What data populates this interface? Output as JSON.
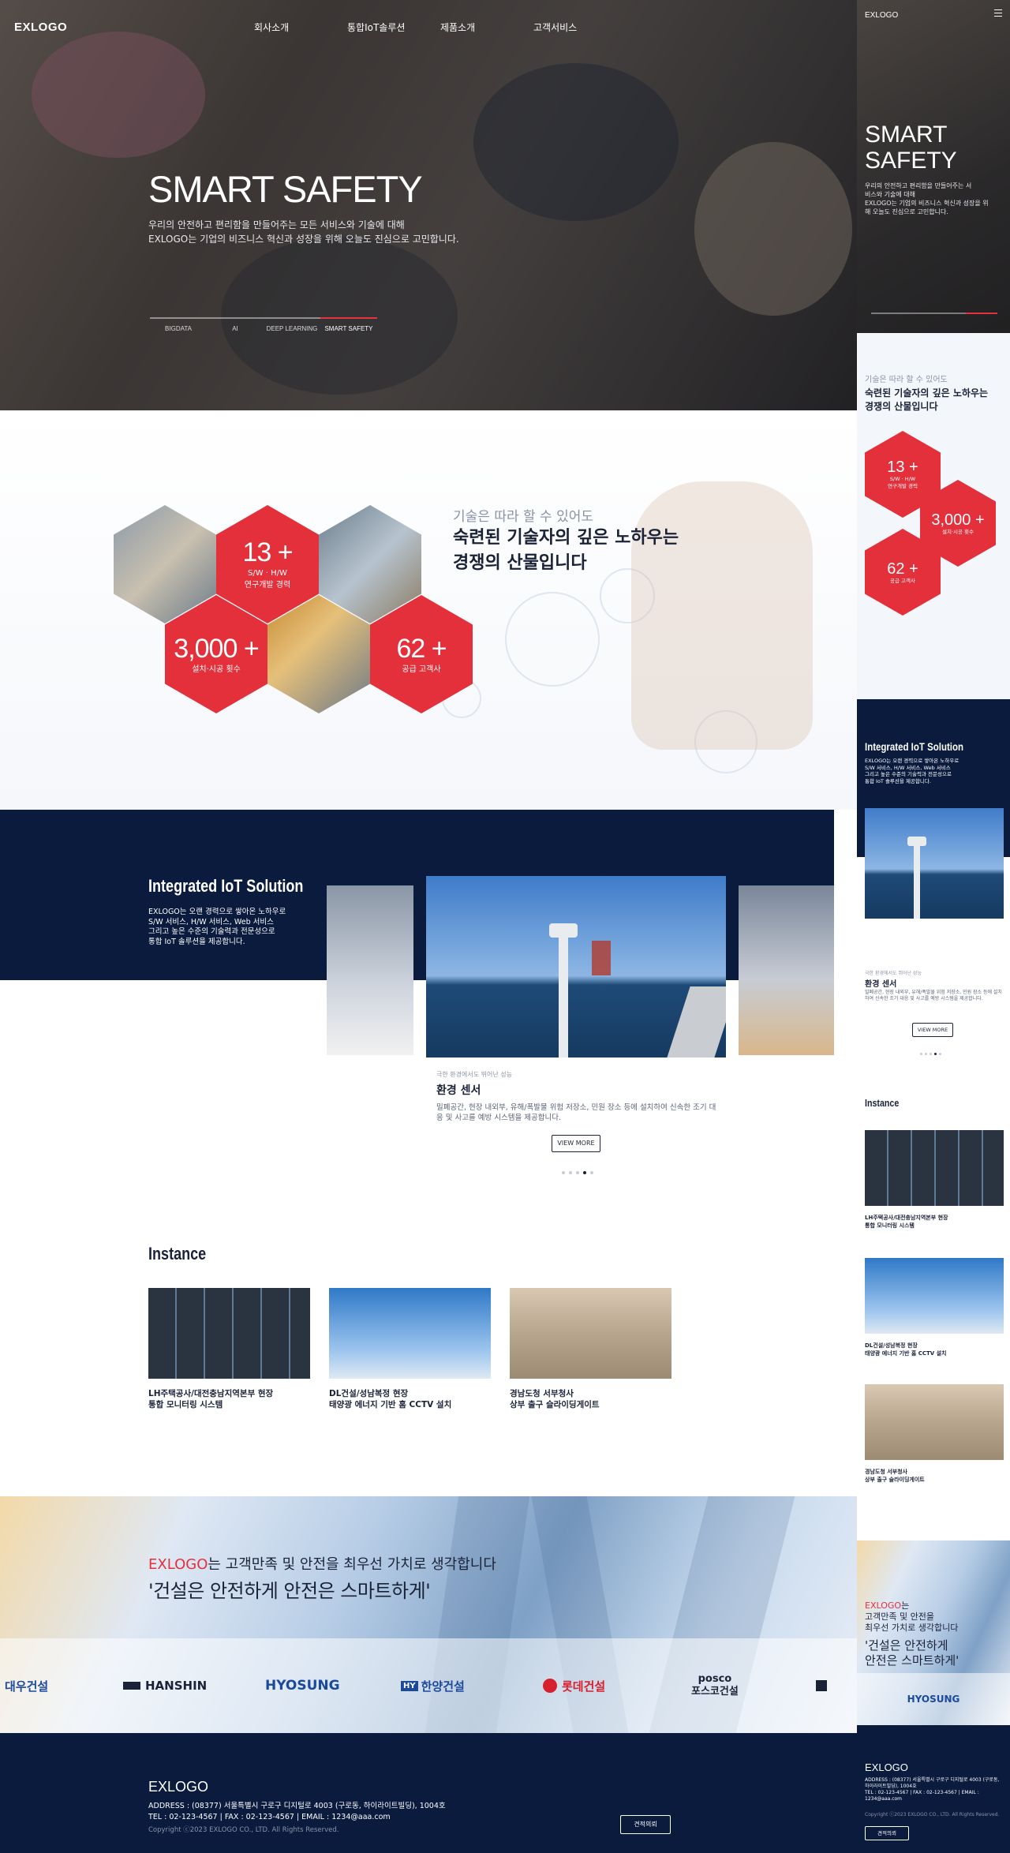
{
  "brand": {
    "logo": "EXLOGO",
    "accent": "#e4303b",
    "navy": "#0b1b3e"
  },
  "nav": {
    "items": [
      "회사소개",
      "통합IoT솔루션",
      "제품소개",
      "고객서비스"
    ]
  },
  "hero": {
    "title": "SMART SAFETY",
    "desc_1": "우리의 안전하고 편리함을 만들어주는 모든 서비스와 기술에 대해",
    "desc_2": "EXLOGO는 기업의 비즈니스 혁신과 성장을 위해 오늘도 진심으로 고민합니다.",
    "tabs": [
      "BIGDATA",
      "AI",
      "DEEP LEARNING",
      "SMART SAFETY"
    ],
    "active_tab": "SMART SAFETY"
  },
  "tech": {
    "subtitle": "기술은 따라 할 수 있어도",
    "headline_1": "숙련된 기술자의 깊은 노하우는",
    "headline_2": "경쟁의 산물입니다",
    "stats": [
      {
        "num": "13 +",
        "label_1": "S/W · H/W",
        "label_2": "연구개발 경력"
      },
      {
        "num": "3,000 +",
        "label_1": "설치·시공 횟수",
        "label_2": ""
      },
      {
        "num": "62 +",
        "label_1": "공급 고객사",
        "label_2": ""
      }
    ]
  },
  "iot": {
    "title": "Integrated IoT Solution",
    "desc_1": "EXLOGO는 오랜 경력으로 쌓아온 노하우로",
    "desc_2": "S/W 서비스, H/W 서비스, Web 서비스",
    "desc_3": "그리고 높은 수준의 기술력과 전문성으로",
    "desc_4": "통합 IoT 솔루션을 제공합니다.",
    "slide_small": "극한 환경에서도 뛰어난 성능",
    "slide_title": "환경 센서",
    "slide_desc": "밀폐공간, 현장 내외부, 유해/폭발물 위험 저장소, 민원 장소 등에 설치하여 신속한 조기 대응 및 사고를 예방 시스템을 제공합니다.",
    "view_more": "VIEW MORE"
  },
  "instance": {
    "title": "Instance",
    "cards": [
      {
        "line_1": "LH주택공사/대전충남지역본부 현장",
        "line_2": "통합 모니터링 시스템"
      },
      {
        "line_1": "DL건설/성남복정 현장",
        "line_2": "태양광 에너지 기반 홈 CCTV 설치"
      },
      {
        "line_1": "경남도청 서부청사",
        "line_2": "상부 출구 슬라이딩게이트"
      }
    ]
  },
  "slogan": {
    "brand": "EXLOGO",
    "line_1_rest": "는 고객만족 및 안전을 최우선 가치로 생각합니다",
    "line_2": "'건설은 안전하게 안전은 스마트하게'",
    "m_line_1a": "는",
    "m_line_1b": "고객만족 및 안전을",
    "m_line_1c": "최우선 가치로 생각합니다",
    "m_line_2a": "'건설은 안전하게",
    "m_line_2b": "안전은 스마트하게'",
    "partners": [
      "대우건설",
      "HANSHIN",
      "HYOSUNG",
      "한양건설",
      "롯데건설",
      "posco",
      "포스코건설"
    ]
  },
  "footer": {
    "logo": "EXLOGO",
    "address": "ADDRESS : (08377) 서울특별시 구로구 디지털로 4003 (구로동, 하이라이트빌딩), 1004호",
    "contact": "TEL : 02-123-4567 | FAX : 02-123-4567 | EMAIL : 1234@aaa.com",
    "copyright": "Copyright ⓒ2023 EXLOGO CO., LTD. All Rights Reserved.",
    "m_address_1": "ADDRESS : (08377) 서울특별시 구로구 디지털로 4003 (구로동,",
    "m_address_2": "하이라이트빌딩), 1004호",
    "m_contact_1": "TEL : 02-123-4567 | FAX : 02-123-4567 | EMAIL :",
    "m_contact_2": "1234@aaa.com",
    "button": "견적의뢰"
  },
  "mobile": {
    "hero_title_1": "SMART",
    "hero_title_2": "SAFETY",
    "hero_desc_1": "우리의 안전하고 편리함을 만들어주는 서",
    "hero_desc_2": "비스와 기술에 대해",
    "hero_desc_3": "EXLOGO는 기업의 비즈니스 혁신과 성장을 위",
    "hero_desc_4": "해 오늘도 진심으로 고민합니다.",
    "tech_head_1": "숙련된 기술자의 깊은 노하우는",
    "tech_head_2": "경쟁의 산물입니다",
    "iot_desc_1": "EXLOGO는 오랜 경력으로 쌓아온 노하우로",
    "iot_desc_2": "S/W 서비스, H/W 서비스, Web 서비스",
    "iot_desc_3": "그리고 높은 수준의 기술력과 전문성으로",
    "iot_desc_4": "통합 IoT 솔루션을 제공합니다.",
    "slide_desc": "밀폐공간, 현장 내외부, 유해/폭발물 위험 저장소, 민원 장소 등에 설치하여 신속한 조기 대응 및 사고를 예방 시스템을 제공합니다.",
    "partner": "HYOSUNG"
  }
}
